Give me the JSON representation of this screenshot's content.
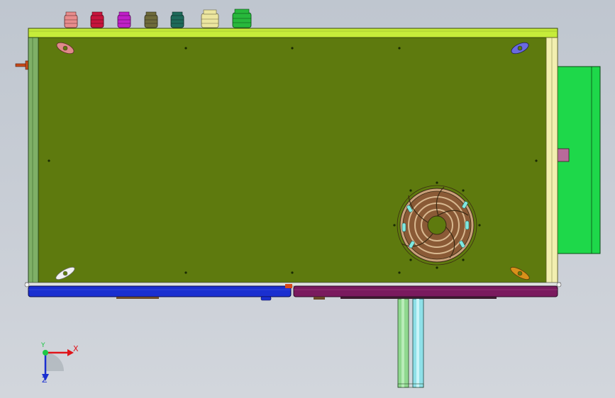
{
  "viewport": {
    "background_top": "#bfc6cf",
    "background_bottom": "#d2d6dc"
  },
  "colors": {
    "panel_face": "#5e7a0e",
    "panel_top_bar": "#c6ec3a",
    "left_rail": "#7fb067",
    "right_rail": "#f2efb0",
    "side_box": "#1ed84a",
    "blue_channel": "#1a2fd0",
    "purple_channel": "#7a1a5e",
    "fan_frame": "#c9a07a",
    "fan_blade": "#8a5a36",
    "pipe_light": "#8fd88f",
    "pipe_cyan": "#8fe0e8",
    "axis_x": "#e0141a",
    "axis_y": "#1a2fd0",
    "axis_origin": "#1ec846"
  },
  "glands": [
    {
      "name": "cable-gland-pink",
      "color": "#e88c8c"
    },
    {
      "name": "cable-gland-red",
      "color": "#c8143c"
    },
    {
      "name": "cable-gland-magenta",
      "color": "#c020c8"
    },
    {
      "name": "cable-gland-olive",
      "color": "#6e6a3a"
    },
    {
      "name": "cable-gland-teal",
      "color": "#1e6a5a"
    },
    {
      "name": "cable-gland-cream",
      "color": "#ece6a0"
    },
    {
      "name": "cable-gland-green",
      "color": "#28b83c"
    }
  ],
  "corner_brackets": [
    {
      "name": "bracket-top-left",
      "color": "#e08a8a"
    },
    {
      "name": "bracket-top-right",
      "color": "#6a6ae0"
    },
    {
      "name": "bracket-bottom-left",
      "color": "#f2f2f2"
    },
    {
      "name": "bracket-bottom-right",
      "color": "#d8901a"
    }
  ],
  "triad": {
    "x_label": "X",
    "y_label": "Y",
    "z_label": "Z"
  }
}
